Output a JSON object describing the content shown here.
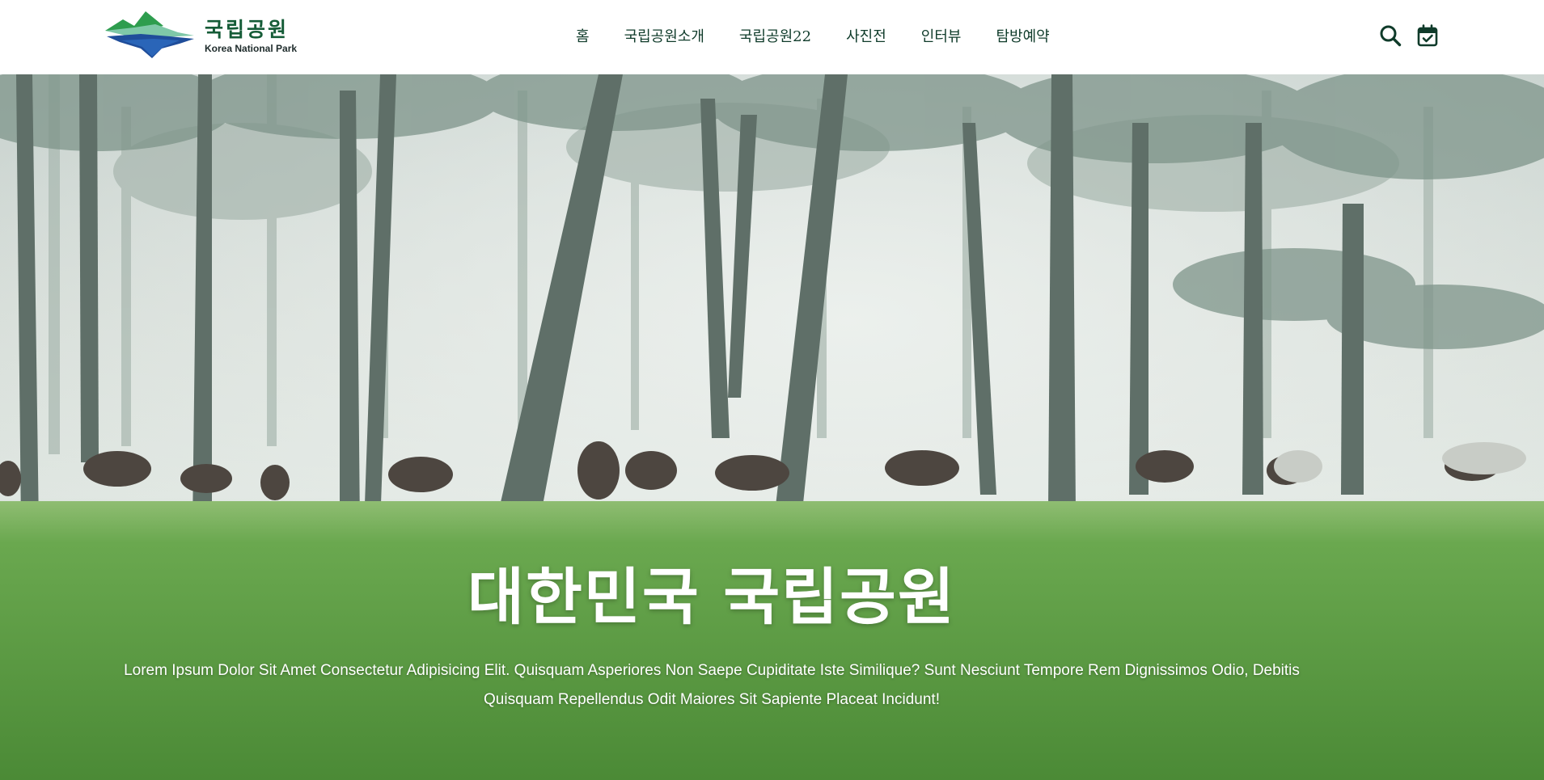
{
  "logo": {
    "title": "국립공원",
    "subtitle": "Korea National Park"
  },
  "nav": {
    "items": [
      {
        "label": "홈"
      },
      {
        "label": "국립공원소개"
      },
      {
        "label": "국립공원22"
      },
      {
        "label": "사진전"
      },
      {
        "label": "인터뷰"
      },
      {
        "label": "탐방예약"
      }
    ]
  },
  "header_icons": {
    "search": "search-icon",
    "calendar": "calendar-check-icon"
  },
  "hero": {
    "title": "대한민국 국립공원",
    "description": "Lorem Ipsum Dolor Sit Amet Consectetur Adipisicing Elit. Quisquam Asperiores Non Saepe Cupiditate Iste Similique? Sunt Nesciunt Tempore Rem Dignissimos Odio, Debitis Quisquam Repellendus Odit Maiores Sit Sapiente Placeat Incidunt!",
    "image": "misty-pine-forest-with-grazing-horses"
  },
  "colors": {
    "brand_green": "#155c37",
    "nav_text": "#0f3b2a",
    "header_bg": "#ffffff"
  }
}
